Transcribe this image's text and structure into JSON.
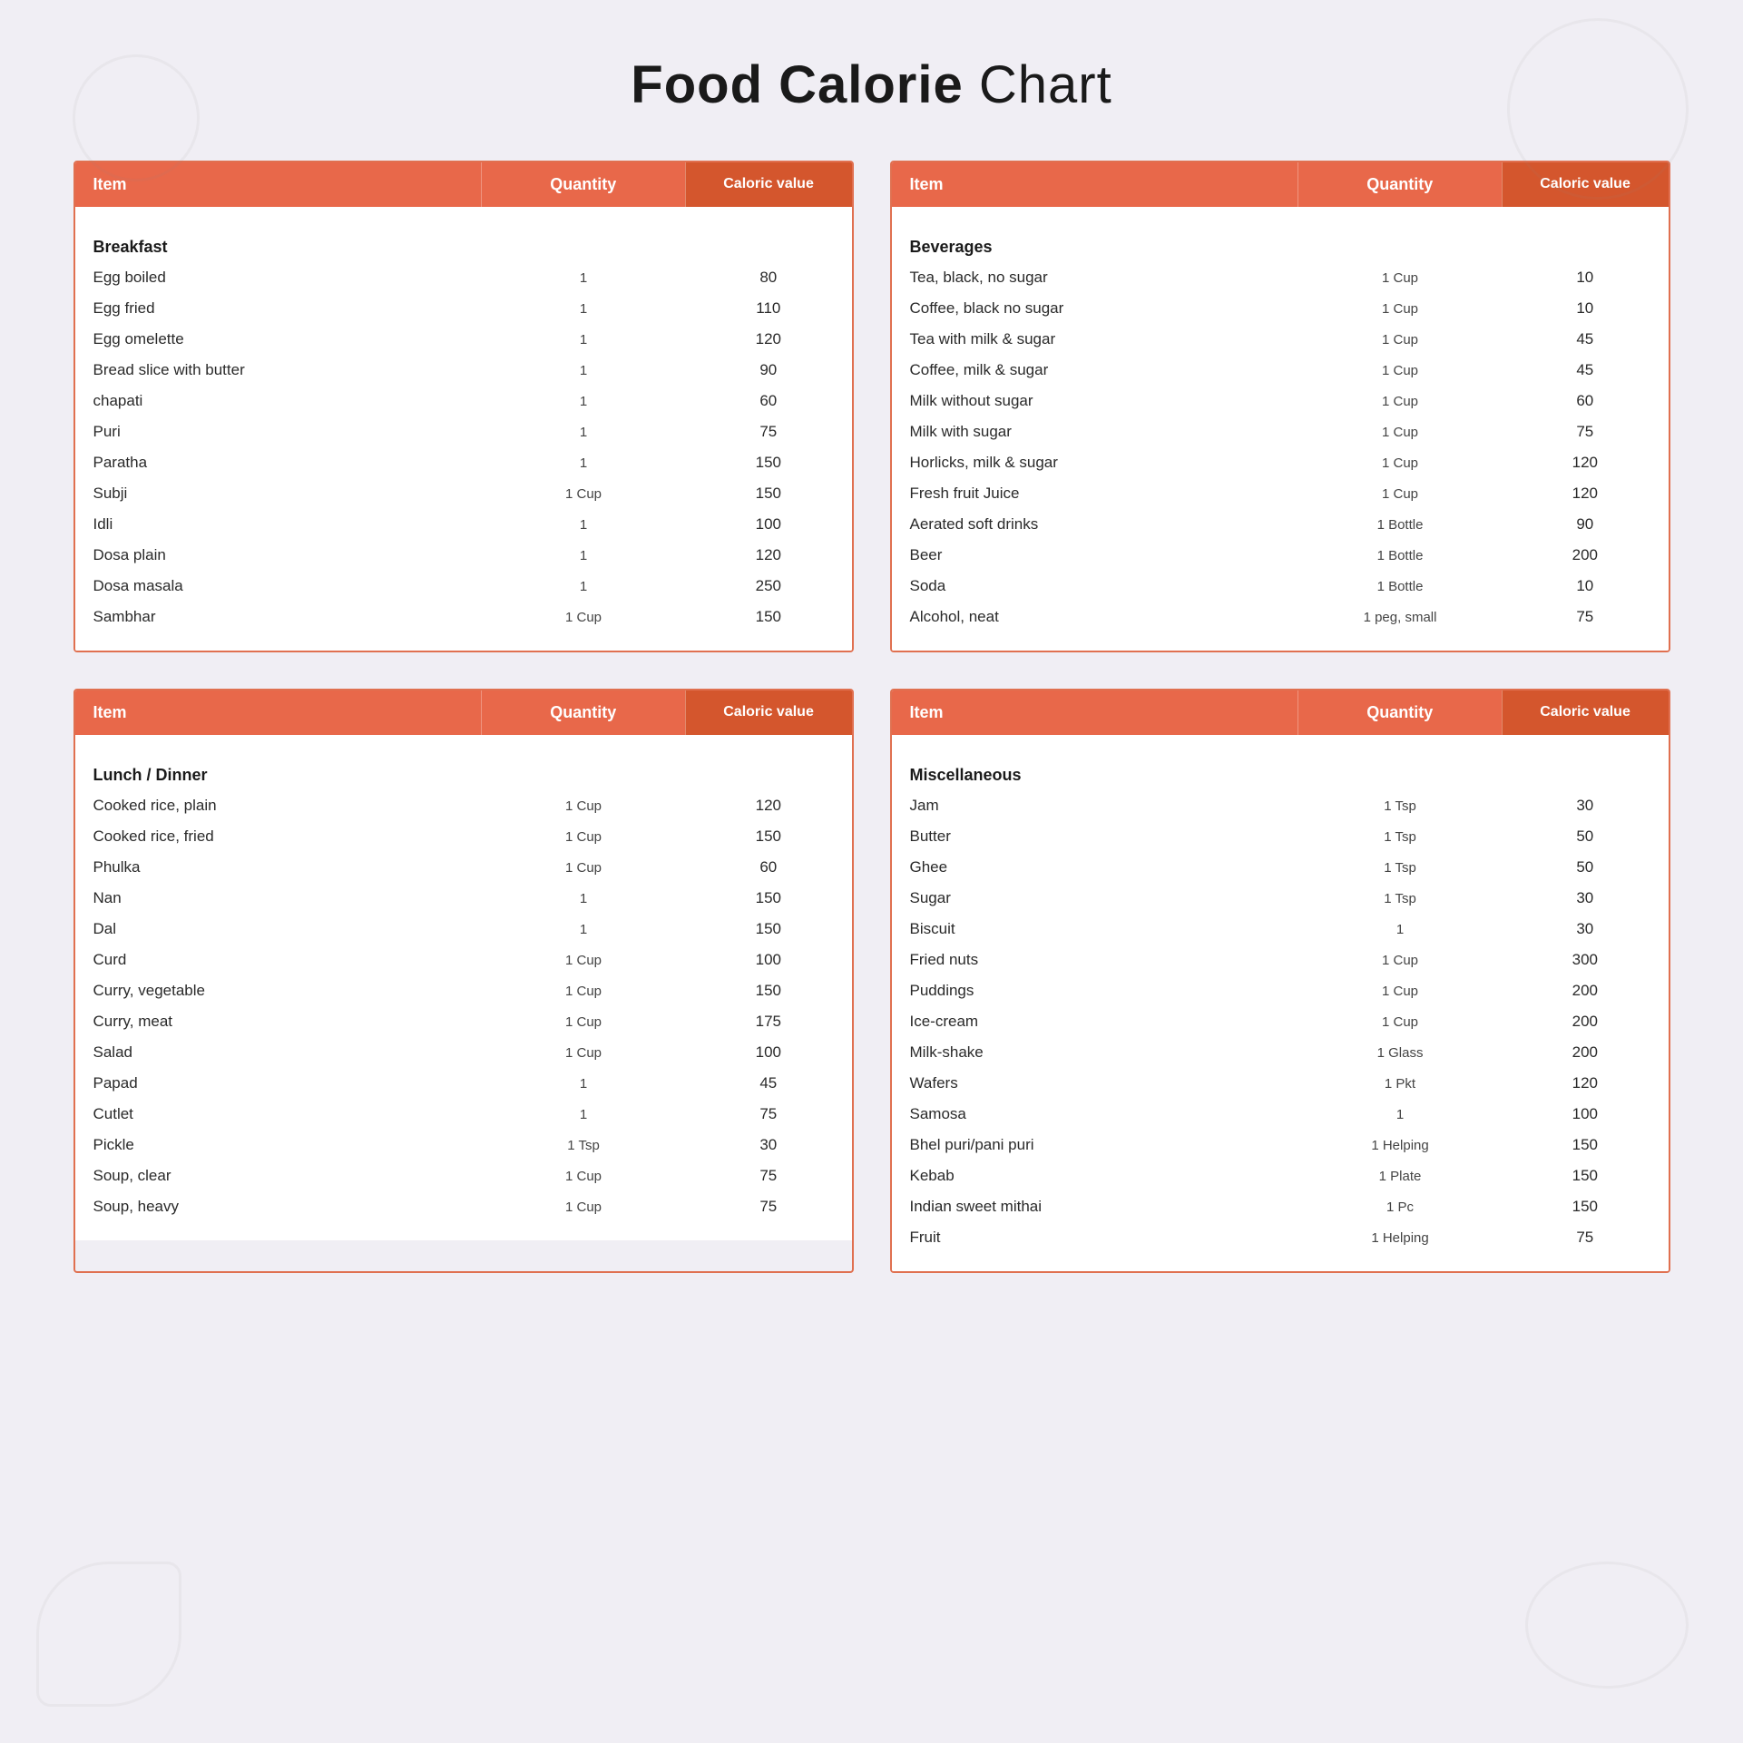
{
  "title": {
    "bold": "Food Calorie",
    "light": " Chart"
  },
  "table1_header": {
    "item": "Item",
    "quantity": "Quantity",
    "caloric": "Caloric value"
  },
  "table2_header": {
    "item": "Item",
    "quantity": "Quantity",
    "caloric": "Caloric value"
  },
  "breakfast": {
    "label": "Breakfast",
    "rows": [
      {
        "item": "Egg boiled",
        "quantity": "1",
        "caloric": "80"
      },
      {
        "item": "Egg fried",
        "quantity": "1",
        "caloric": "110"
      },
      {
        "item": "Egg omelette",
        "quantity": "1",
        "caloric": "120"
      },
      {
        "item": "Bread slice with butter",
        "quantity": "1",
        "caloric": "90"
      },
      {
        "item": "chapati",
        "quantity": "1",
        "caloric": "60"
      },
      {
        "item": "Puri",
        "quantity": "1",
        "caloric": "75"
      },
      {
        "item": "Paratha",
        "quantity": "1",
        "caloric": "150"
      },
      {
        "item": "Subji",
        "quantity": "1 Cup",
        "caloric": "150"
      },
      {
        "item": "Idli",
        "quantity": "1",
        "caloric": "100"
      },
      {
        "item": "Dosa plain",
        "quantity": "1",
        "caloric": "120"
      },
      {
        "item": "Dosa masala",
        "quantity": "1",
        "caloric": "250"
      },
      {
        "item": "Sambhar",
        "quantity": "1 Cup",
        "caloric": "150"
      }
    ]
  },
  "lunch_dinner": {
    "label": "Lunch / Dinner",
    "rows": [
      {
        "item": "Cooked rice, plain",
        "quantity": "1 Cup",
        "caloric": "120"
      },
      {
        "item": "Cooked rice, fried",
        "quantity": "1 Cup",
        "caloric": "150"
      },
      {
        "item": "Phulka",
        "quantity": "1 Cup",
        "caloric": "60"
      },
      {
        "item": "Nan",
        "quantity": "1",
        "caloric": "150"
      },
      {
        "item": "Dal",
        "quantity": "1",
        "caloric": "150"
      },
      {
        "item": "Curd",
        "quantity": "1 Cup",
        "caloric": "100"
      },
      {
        "item": "Curry, vegetable",
        "quantity": "1 Cup",
        "caloric": "150"
      },
      {
        "item": "Curry, meat",
        "quantity": "1 Cup",
        "caloric": "175"
      },
      {
        "item": "Salad",
        "quantity": "1 Cup",
        "caloric": "100"
      },
      {
        "item": "Papad",
        "quantity": "1",
        "caloric": "45"
      },
      {
        "item": "Cutlet",
        "quantity": "1",
        "caloric": "75"
      },
      {
        "item": "Pickle",
        "quantity": "1 Tsp",
        "caloric": "30"
      },
      {
        "item": "Soup, clear",
        "quantity": "1 Cup",
        "caloric": "75"
      },
      {
        "item": "Soup, heavy",
        "quantity": "1 Cup",
        "caloric": "75"
      }
    ]
  },
  "beverages": {
    "label": "Beverages",
    "rows": [
      {
        "item": "Tea, black, no sugar",
        "quantity": "1 Cup",
        "caloric": "10"
      },
      {
        "item": "Coffee, black no sugar",
        "quantity": "1 Cup",
        "caloric": "10"
      },
      {
        "item": "Tea with milk & sugar",
        "quantity": "1 Cup",
        "caloric": "45"
      },
      {
        "item": "Coffee, milk & sugar",
        "quantity": "1 Cup",
        "caloric": "45"
      },
      {
        "item": "Milk without sugar",
        "quantity": "1 Cup",
        "caloric": "60"
      },
      {
        "item": "Milk with sugar",
        "quantity": "1 Cup",
        "caloric": "75"
      },
      {
        "item": "Horlicks, milk & sugar",
        "quantity": "1 Cup",
        "caloric": "120"
      },
      {
        "item": "Fresh fruit Juice",
        "quantity": "1 Cup",
        "caloric": "120"
      },
      {
        "item": "Aerated soft drinks",
        "quantity": "1 Bottle",
        "caloric": "90"
      },
      {
        "item": "Beer",
        "quantity": "1 Bottle",
        "caloric": "200"
      },
      {
        "item": "Soda",
        "quantity": "1 Bottle",
        "caloric": "10"
      },
      {
        "item": "Alcohol, neat",
        "quantity": "1 peg, small",
        "caloric": "75"
      }
    ]
  },
  "miscellaneous": {
    "label": "Miscellaneous",
    "rows": [
      {
        "item": "Jam",
        "quantity": "1 Tsp",
        "caloric": "30"
      },
      {
        "item": "Butter",
        "quantity": "1 Tsp",
        "caloric": "50"
      },
      {
        "item": "Ghee",
        "quantity": "1 Tsp",
        "caloric": "50"
      },
      {
        "item": "Sugar",
        "quantity": "1 Tsp",
        "caloric": "30"
      },
      {
        "item": "Biscuit",
        "quantity": "1",
        "caloric": "30"
      },
      {
        "item": "Fried nuts",
        "quantity": "1 Cup",
        "caloric": "300"
      },
      {
        "item": "Puddings",
        "quantity": "1 Cup",
        "caloric": "200"
      },
      {
        "item": "Ice-cream",
        "quantity": "1 Cup",
        "caloric": "200"
      },
      {
        "item": "Milk-shake",
        "quantity": "1 Glass",
        "caloric": "200"
      },
      {
        "item": "Wafers",
        "quantity": "1 Pkt",
        "caloric": "120"
      },
      {
        "item": "Samosa",
        "quantity": "1",
        "caloric": "100"
      },
      {
        "item": "Bhel puri/pani puri",
        "quantity": "1 Helping",
        "caloric": "150"
      },
      {
        "item": "Kebab",
        "quantity": "1 Plate",
        "caloric": "150"
      },
      {
        "item": "Indian sweet mithai",
        "quantity": "1 Pc",
        "caloric": "150"
      },
      {
        "item": "Fruit",
        "quantity": "1 Helping",
        "caloric": "75"
      }
    ]
  }
}
